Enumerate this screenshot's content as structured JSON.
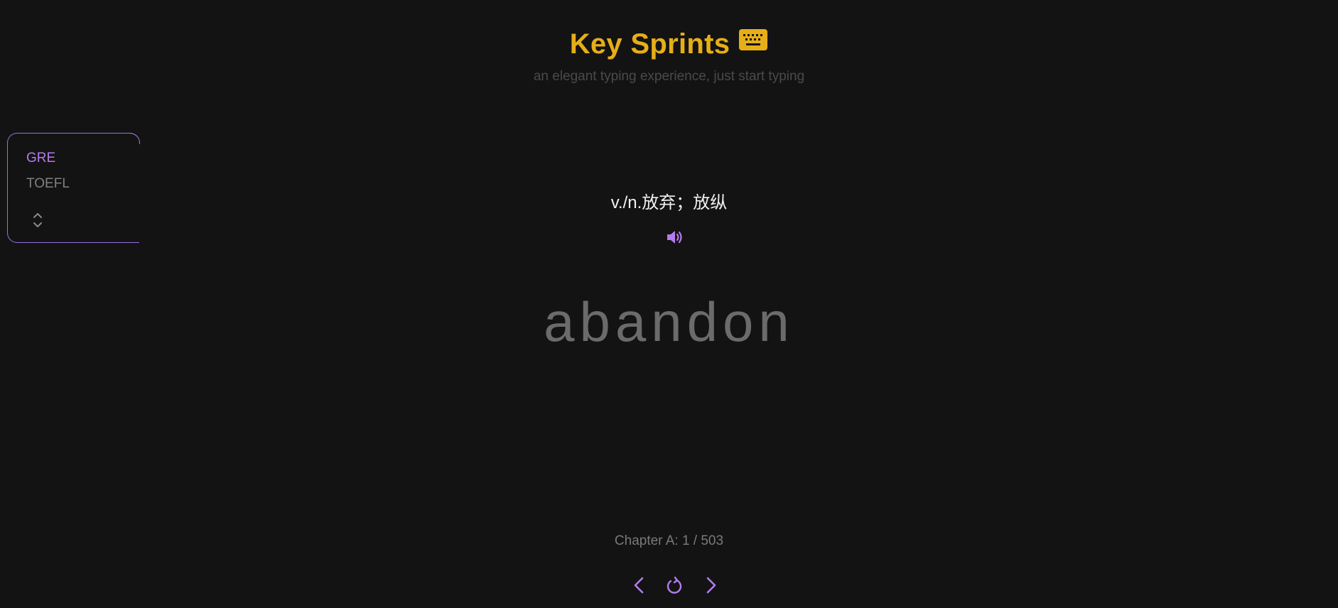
{
  "header": {
    "title": "Key Sprints",
    "subtitle": "an elegant typing experience, just start typing",
    "icon": "keyboard-icon"
  },
  "dictionaries": {
    "items": [
      {
        "label": "GRE",
        "active": true
      },
      {
        "label": "TOEFL",
        "active": false
      }
    ],
    "expand_icon": "chevron-up-down-icon"
  },
  "word_card": {
    "translation": "v./n.放弃；放纵",
    "speaker_icon": "speaker-icon",
    "word": "abandon"
  },
  "footer": {
    "progress": "Chapter A: 1 / 503",
    "prev_icon": "chevron-left-icon",
    "refresh_icon": "refresh-icon",
    "next_icon": "chevron-right-icon"
  },
  "colors": {
    "background": "#131313",
    "title": "#e6ae18",
    "accent": "#b57bee",
    "word": "#6b6b6b",
    "muted": "#808080"
  }
}
